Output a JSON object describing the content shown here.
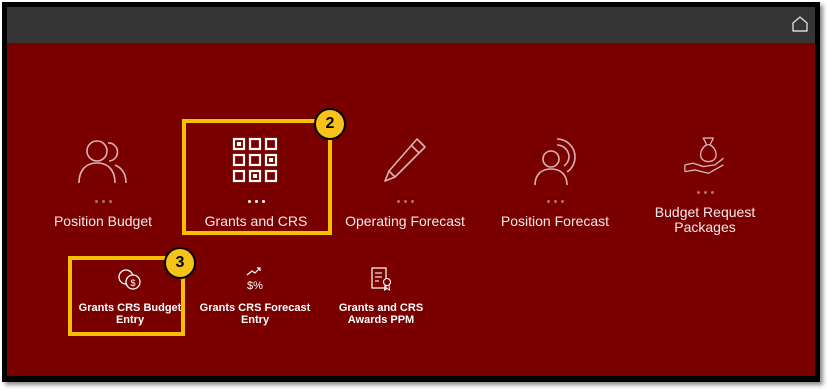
{
  "header": {
    "home_icon": "home-icon"
  },
  "tiles_large": [
    {
      "label": "Position Budget",
      "icon": "users-icon"
    },
    {
      "label": "Grants and CRS",
      "icon": "grid-icon"
    },
    {
      "label": "Operating Forecast",
      "icon": "pencil-icon"
    },
    {
      "label": "Position Forecast",
      "icon": "user-target-icon"
    },
    {
      "label": "Budget Request Packages",
      "icon": "money-bag-hand-icon"
    }
  ],
  "tiles_small": [
    {
      "label": "Grants CRS Budget Entry",
      "icon": "currency-coins-icon"
    },
    {
      "label": "Grants CRS Forecast Entry",
      "icon": "trend-dollar-percent-icon"
    },
    {
      "label": "Grants and CRS Awards PPM",
      "icon": "award-document-icon"
    }
  ],
  "callouts": {
    "step2": "2",
    "step3": "3"
  },
  "colors": {
    "panel": "#7a0000",
    "topbar": "#353535",
    "highlight": "#f5c000"
  }
}
